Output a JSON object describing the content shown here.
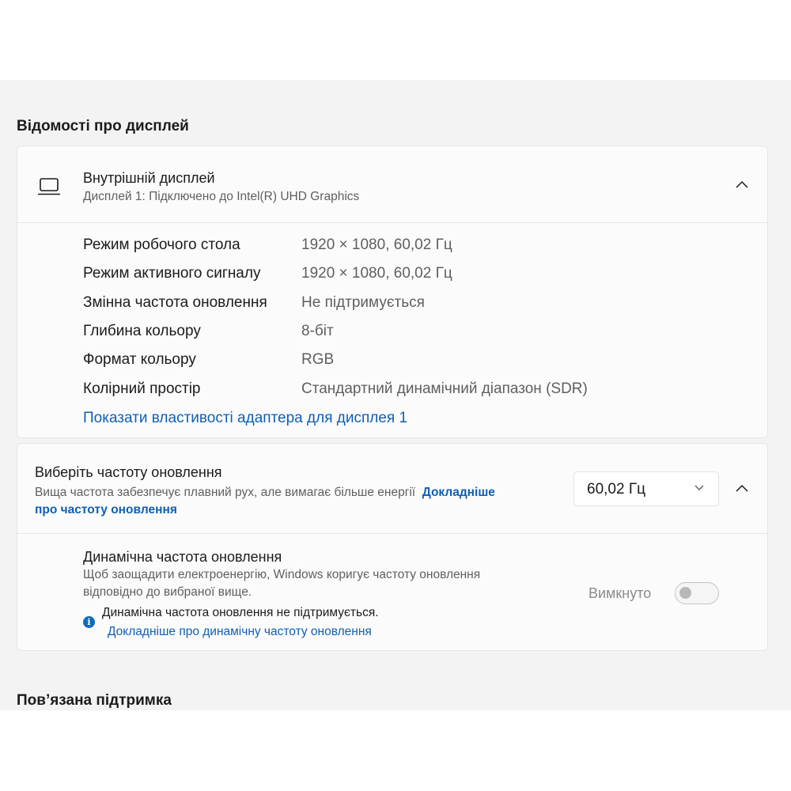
{
  "display_info": {
    "section_title": "Відомості про дисплей",
    "display": {
      "title": "Внутрішній дисплей",
      "subtitle": "Дисплей 1: Підключено до Intel(R) UHD Graphics",
      "icon": "laptop-icon",
      "expanded": true
    },
    "properties": [
      {
        "label": "Режим робочого стола",
        "value": "1920 × 1080, 60,02 Гц"
      },
      {
        "label": "Режим активного сигналу",
        "value": "1920 × 1080, 60,02 Гц"
      },
      {
        "label": "Змінна частота оновлення",
        "value": "Не підтримується"
      },
      {
        "label": "Глибина кольору",
        "value": "8-біт"
      },
      {
        "label": "Формат кольору",
        "value": "RGB"
      },
      {
        "label": "Колірний простір",
        "value": "Стандартний динамічний діапазон (SDR)"
      }
    ],
    "adapter_link": "Показати властивості адаптера для дисплея 1"
  },
  "refresh_rate": {
    "title": "Виберіть частоту оновлення",
    "subtitle": "Вища частота забезпечує плавний рух, але вимагає більше енергії",
    "learn_more_part1": "Докладніше",
    "learn_more_part2": "про частоту оновлення",
    "selected": "60,02 Гц",
    "dynamic": {
      "title": "Динамічна частота оновлення",
      "description_line1": "Щоб заощадити електроенергію, Windows коригує частоту оновлення",
      "description_line2": "відповідно до вибраної вище.",
      "toggle_label": "Вимкнуто",
      "toggle_on": false,
      "info_text": "Динамічна частота оновлення не підтримується.",
      "info_link": "Докладніше про динамічну частоту оновлення"
    }
  },
  "related_support": {
    "section_title": "Пов’язана підтримка"
  },
  "colors": {
    "accent_link": "#0f5fb5",
    "info_icon": "#0f6cbd",
    "panel_bg": "#f3f3f3",
    "card_bg": "#fbfbfb"
  }
}
